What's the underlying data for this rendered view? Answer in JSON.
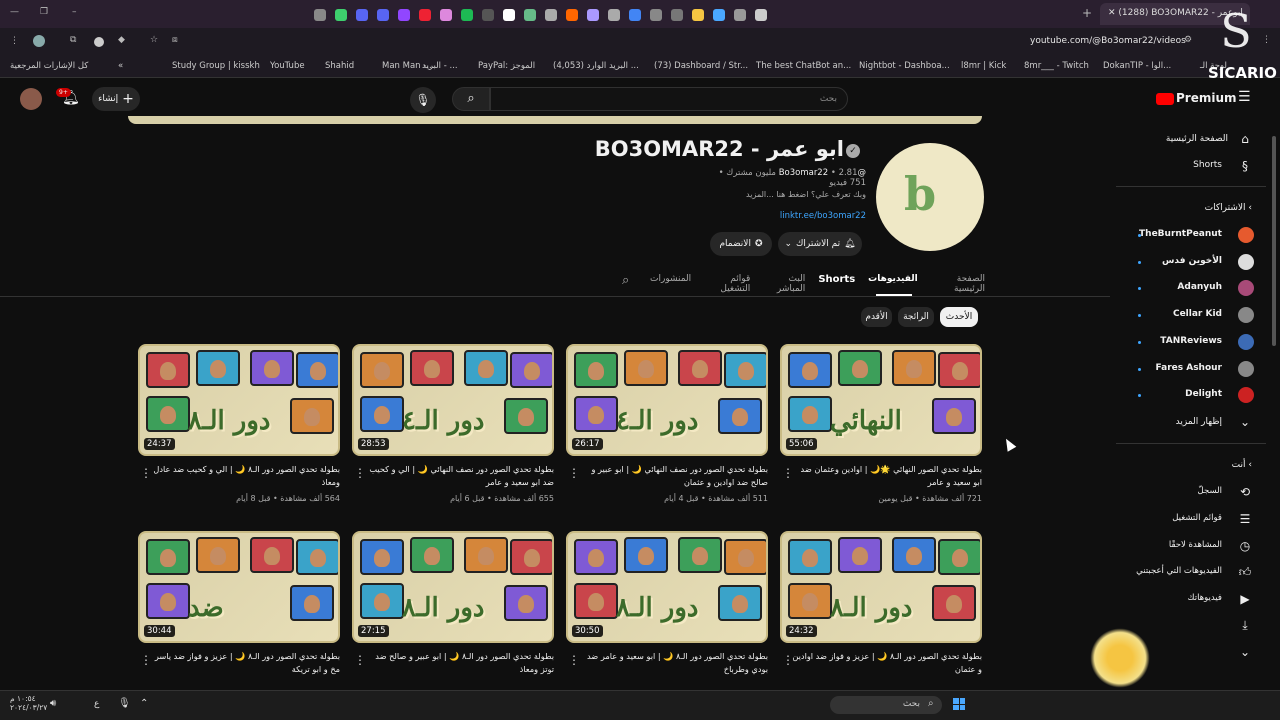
{
  "browser": {
    "active_tab": "(1288) BO3OMAR22 - ابوعمر",
    "url": "youtube.com/@Bo3omar22/videos",
    "bookmarks": [
      "كل الإشارات المرجعية",
      "Study Group | kisskh",
      "YouTube",
      "Shahid",
      "Man Man -...",
      "البريد - ...",
      "PayPal: الموجز",
      "(4,053) البريد الوارد ...",
      "(73) Dashboard / Str...",
      "The best ChatBot an...",
      "Nightbot - Dashboa...",
      "l8mr | Kick",
      "8mr___ - Twitch",
      "DokanTIP - الوا...",
      "لوحة الـ"
    ]
  },
  "header": {
    "premium": "Premium",
    "search_placeholder": "بحث",
    "create_label": "إنشاء",
    "notif_count": "9+"
  },
  "channel": {
    "name": "ابو عمر - BO3OMAR22",
    "handle": "@Bo3omar22",
    "stats": "2.81 مليون مشترك • 751 فيديو",
    "description": "وبك تعرف علي؟ اضغط هنا ...المزيد",
    "link": "linktr.ee/bo3omar22",
    "subscribed_label": "تم الاشتراك",
    "join_label": "الانضمام"
  },
  "tabs": [
    "الصفحة الرئيسية",
    "الفيديوهات",
    "Shorts",
    "البث المباشر",
    "قوائم التشغيل",
    "المنشورات"
  ],
  "filters": [
    "الأحدث",
    "الرائجة",
    "الأقدم"
  ],
  "videos": [
    {
      "title": "بطولة تحدي الصور النهائي 🌟🌙 | اوادين وعثمان ضد ابو سعيد و عامر",
      "meta": "721 ألف مشاهدة • قبل يومين",
      "duration": "55:06",
      "word": "النهائي"
    },
    {
      "title": "بطولة تحدي الصور دور نصف النهائي 🌙 | ابو عبير و صالح ضد اوادين و عثمان",
      "meta": "511 ألف مشاهدة • قبل 4 أيام",
      "duration": "26:17",
      "word": "دور الـ٤"
    },
    {
      "title": "بطولة تحدي الصور دور نصف النهائي 🌙 | الي و كحيب ضد ابو سعيد و عامر",
      "meta": "655 ألف مشاهدة • قبل 6 أيام",
      "duration": "28:53",
      "word": "دور الـ٤"
    },
    {
      "title": "بطولة تحدي الصور دور الـ٨ 🌙 | الي و كحيب ضد عادل ومعاذ",
      "meta": "564 ألف مشاهدة • قبل 8 أيام",
      "duration": "24:37",
      "word": "دور الـ٨"
    },
    {
      "title": "بطولة تحدي الصور دور الـ٨ 🌙 | عزيز و فواز ضد اوادين و عثمان",
      "meta": "",
      "duration": "24:32",
      "word": "دور الـ٨"
    },
    {
      "title": "بطولة تحدي الصور دور الـ٨ 🌙 | ابو سعيد و عامر ضد بودي وطرباخ",
      "meta": "",
      "duration": "30:50",
      "word": "دور الـ٨"
    },
    {
      "title": "بطولة تحدي الصور دور الـ٨ 🌙 | ابو عبير و صالح ضد توتز ومعاذ",
      "meta": "",
      "duration": "27:15",
      "word": "دور الـ٨"
    },
    {
      "title": "بطولة تحدي الصور دور الـ٨ 🌙 | عزيز و فواز ضد ياسر مخ و ابو تريكة",
      "meta": "",
      "duration": "30:44",
      "word": "ضد"
    }
  ],
  "sidebar": {
    "home": "الصفحة الرئيسية",
    "shorts": "Shorts",
    "subs_header": "الاشتراكات",
    "subs": [
      "TheBurntPeanut",
      "الأخوين فدس",
      "Adanyuh",
      "Cellar Kid",
      "TANReviews",
      "Fares Ashour",
      "Delight"
    ],
    "show_more": "إظهار المزيد",
    "you_header": "أنت",
    "you_items": [
      "السجلّ",
      "قوائم التشغيل",
      "المشاهدة لاحقًا",
      "الفيديوهات التي أعجبتني",
      "فيديوهاتك"
    ]
  },
  "taskbar": {
    "search": "بحث",
    "time": "١٠:٥٤ م",
    "date": "٢٠٢٤/٠٣/٢٧",
    "lang": "ع"
  },
  "watermark": "SICARIO",
  "colors": {
    "accent": "#3ea6ff",
    "red": "#ff0000",
    "thumb_bg": "#e3d9b0"
  }
}
